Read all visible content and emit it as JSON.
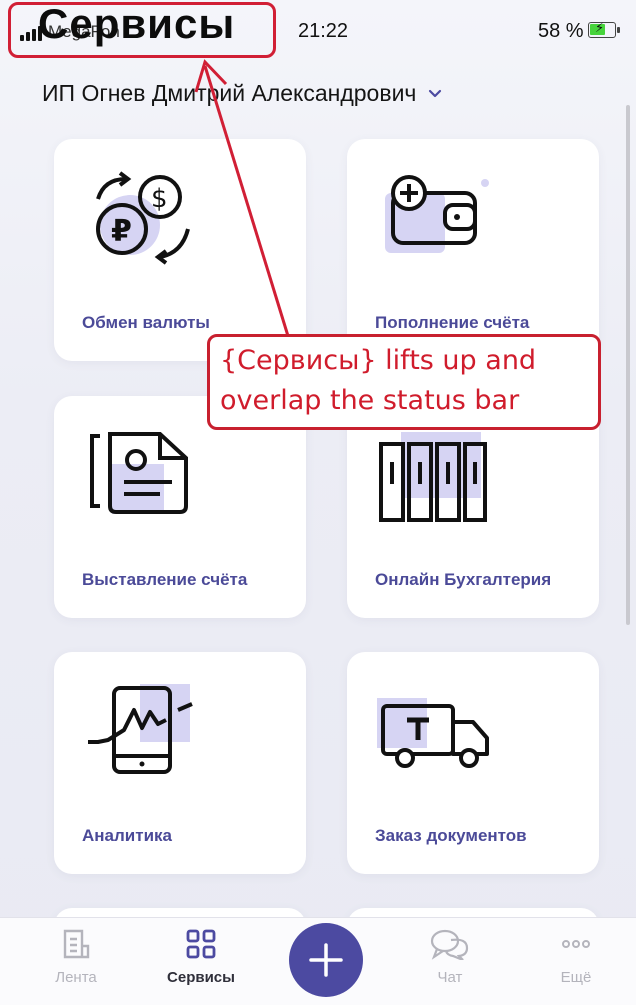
{
  "status_bar": {
    "carrier": "MegaFon",
    "time": "21:22",
    "battery_text": "58 %"
  },
  "page_title": "Сервисы",
  "account": {
    "name": "ИП Огнев Дмитрий Александрович"
  },
  "services": [
    {
      "label": "Обмен валюты",
      "icon": "currency-exchange-icon"
    },
    {
      "label": "Пополнение счёта",
      "icon": "wallet-add-icon"
    },
    {
      "label": "Выставление счёта",
      "icon": "invoice-document-icon"
    },
    {
      "label": "Онлайн Бухгалтерия",
      "icon": "accounting-binders-icon"
    },
    {
      "label": "Аналитика",
      "icon": "phone-analytics-icon"
    },
    {
      "label": "Заказ документов",
      "icon": "delivery-truck-icon"
    }
  ],
  "annotation": {
    "text": "{Сервисы} lifts up and overlap the status bar"
  },
  "bottom_nav": {
    "items": [
      {
        "label": "Лента",
        "icon": "feed-icon",
        "active": false
      },
      {
        "label": "Сервисы",
        "icon": "services-grid-icon",
        "active": true
      },
      {
        "label": "",
        "icon": "plus-icon",
        "active": false
      },
      {
        "label": "Чат",
        "icon": "chat-icon",
        "active": false
      },
      {
        "label": "Ещё",
        "icon": "more-icon",
        "active": false
      }
    ]
  },
  "colors": {
    "accent": "#4c4aa1",
    "annotation": "#d11f35",
    "icon_highlight": "#d6d4f3"
  }
}
